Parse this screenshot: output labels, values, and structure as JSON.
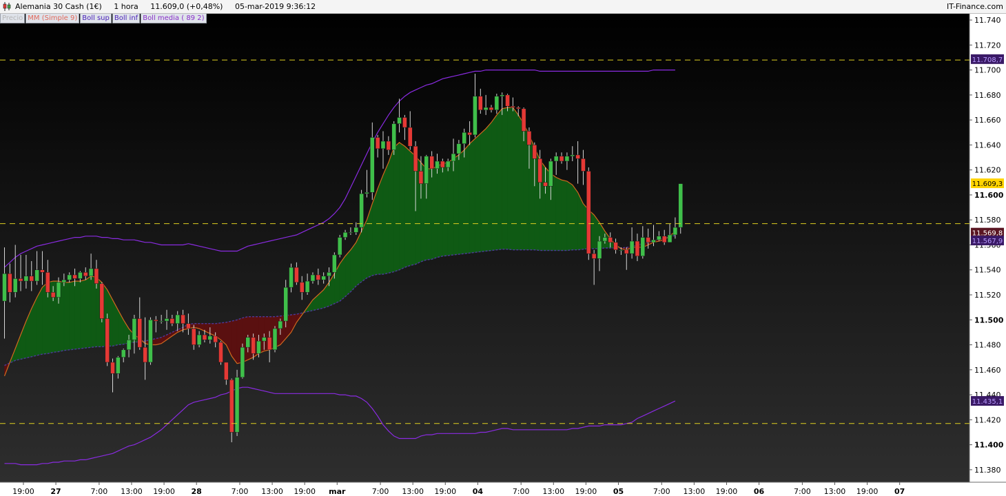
{
  "header": {
    "instrument": "Alemania 30 Cash (1€)",
    "timeframe": "1 hora",
    "quote": "11.609,0 (+0,48%)",
    "timestamp": "05-mar-2019 9:36:12",
    "brand": "IT-Finance.com"
  },
  "legend": [
    {
      "label": "Precio"
    },
    {
      "label": "MM (Simple 9)"
    },
    {
      "label": "Boll sup"
    },
    {
      "label": "Boll inf"
    },
    {
      "label": "Boll media ( 89 2)"
    }
  ],
  "colors": {
    "up": "#3fbf4a",
    "down": "#e53935",
    "sma": "#d2691e",
    "bollinger": "#8a2be2",
    "level": "#e0d020",
    "fill_above": "#0f5a14",
    "fill_below": "#5a1010",
    "last_price_tag": "#ffd400"
  },
  "chart_data": {
    "type": "candlestick",
    "ylim": [
      11370,
      11745
    ],
    "yticks": [
      "11.740",
      "11.720",
      "11.700",
      "11.680",
      "11.660",
      "11.640",
      "11.620",
      "11.600",
      "11.580",
      "11.560",
      "11.540",
      "11.520",
      "11.500",
      "11.480",
      "11.460",
      "11.440",
      "11.420",
      "11.400",
      "11.380"
    ],
    "yticks_bold": [
      "11.600",
      "11.500",
      "11.400"
    ],
    "xticks": [
      {
        "i": 3.5,
        "label": "19:00",
        "bold": false
      },
      {
        "i": 9.5,
        "label": "27",
        "bold": true
      },
      {
        "i": 17.5,
        "label": "7:00",
        "bold": false
      },
      {
        "i": 23.5,
        "label": "13:00",
        "bold": false
      },
      {
        "i": 29.5,
        "label": "19:00",
        "bold": false
      },
      {
        "i": 35.5,
        "label": "28",
        "bold": true
      },
      {
        "i": 43.5,
        "label": "7:00",
        "bold": false
      },
      {
        "i": 49.5,
        "label": "13:00",
        "bold": false
      },
      {
        "i": 55.5,
        "label": "19:00",
        "bold": false
      },
      {
        "i": 61.5,
        "label": "mar",
        "bold": true
      },
      {
        "i": 69.5,
        "label": "7:00",
        "bold": false
      },
      {
        "i": 75.5,
        "label": "13:00",
        "bold": false
      },
      {
        "i": 81.5,
        "label": "19:00",
        "bold": false
      },
      {
        "i": 87.5,
        "label": "04",
        "bold": true
      },
      {
        "i": 95.5,
        "label": "7:00",
        "bold": false
      },
      {
        "i": 101.5,
        "label": "13:00",
        "bold": false
      },
      {
        "i": 107.5,
        "label": "19:00",
        "bold": false
      },
      {
        "i": 113.5,
        "label": "05",
        "bold": true
      },
      {
        "i": 121.5,
        "label": "7:00",
        "bold": false
      },
      {
        "i": 127.5,
        "label": "13:00",
        "bold": false
      },
      {
        "i": 133.5,
        "label": "19:00",
        "bold": false
      },
      {
        "i": 139.5,
        "label": "06",
        "bold": true
      },
      {
        "i": 147.5,
        "label": "7:00",
        "bold": false
      },
      {
        "i": 153.5,
        "label": "13:00",
        "bold": false
      },
      {
        "i": 159.5,
        "label": "19:00",
        "bold": false
      },
      {
        "i": 165.5,
        "label": "07",
        "bold": true
      }
    ],
    "candles": [
      [
        11515,
        11537,
        11558,
        11485
      ],
      [
        11537,
        11522,
        11545,
        11514
      ],
      [
        11522,
        11533,
        11560,
        11518
      ],
      [
        11533,
        11531,
        11552,
        11523
      ],
      [
        11531,
        11535,
        11552,
        11525
      ],
      [
        11535,
        11531,
        11547,
        11523
      ],
      [
        11531,
        11540,
        11555,
        11528
      ],
      [
        11540,
        11538,
        11555,
        11528
      ],
      [
        11538,
        11522,
        11548,
        11518
      ],
      [
        11522,
        11518,
        11527,
        11515
      ],
      [
        11518,
        11530,
        11534,
        11513
      ],
      [
        11530,
        11532,
        11537,
        11527
      ],
      [
        11532,
        11536,
        11538,
        11530
      ],
      [
        11536,
        11533,
        11541,
        11527
      ],
      [
        11533,
        11538,
        11539,
        11530
      ],
      [
        11538,
        11535,
        11542,
        11532
      ],
      [
        11535,
        11541,
        11553,
        11532
      ],
      [
        11541,
        11529,
        11548,
        11525
      ],
      [
        11529,
        11501,
        11530,
        11498
      ],
      [
        11501,
        11466,
        11505,
        11463
      ],
      [
        11466,
        11457,
        11469,
        11442
      ],
      [
        11457,
        11470,
        11471,
        11453
      ],
      [
        11470,
        11476,
        11477,
        11466
      ],
      [
        11476,
        11484,
        11488,
        11470
      ],
      [
        11484,
        11501,
        11504,
        11473
      ],
      [
        11501,
        11478,
        11518,
        11476
      ],
      [
        11478,
        11466,
        11502,
        11452
      ],
      [
        11466,
        11500,
        11502,
        11464
      ],
      [
        11500,
        11499,
        11503,
        11490
      ],
      [
        11499,
        11499,
        11504,
        11497
      ],
      [
        11499,
        11501,
        11508,
        11492
      ],
      [
        11501,
        11497,
        11504,
        11495
      ],
      [
        11497,
        11504,
        11507,
        11491
      ],
      [
        11504,
        11497,
        11508,
        11490
      ],
      [
        11497,
        11493,
        11505,
        11488
      ],
      [
        11493,
        11480,
        11496,
        11476
      ],
      [
        11480,
        11488,
        11491,
        11478
      ],
      [
        11488,
        11484,
        11492,
        11482
      ],
      [
        11484,
        11487,
        11494,
        11481
      ],
      [
        11487,
        11482,
        11490,
        11478
      ],
      [
        11482,
        11466,
        11483,
        11464
      ],
      [
        11466,
        11452,
        11466,
        11448
      ],
      [
        11452,
        11410,
        11453,
        11402
      ],
      [
        11410,
        11454,
        11460,
        11407
      ],
      [
        11454,
        11478,
        11481,
        11453
      ],
      [
        11478,
        11486,
        11488,
        11474
      ],
      [
        11486,
        11473,
        11489,
        11468
      ],
      [
        11473,
        11483,
        11488,
        11470
      ],
      [
        11483,
        11486,
        11489,
        11476
      ],
      [
        11486,
        11476,
        11491,
        11466
      ],
      [
        11476,
        11493,
        11495,
        11474
      ],
      [
        11493,
        11499,
        11501,
        11488
      ],
      [
        11499,
        11526,
        11532,
        11494
      ],
      [
        11526,
        11542,
        11545,
        11522
      ],
      [
        11542,
        11530,
        11546,
        11528
      ],
      [
        11530,
        11522,
        11535,
        11516
      ],
      [
        11522,
        11531,
        11537,
        11520
      ],
      [
        11531,
        11536,
        11538,
        11529
      ],
      [
        11536,
        11532,
        11541,
        11528
      ],
      [
        11532,
        11535,
        11538,
        11529
      ],
      [
        11535,
        11538,
        11542,
        11527
      ],
      [
        11538,
        11552,
        11554,
        11533
      ],
      [
        11552,
        11566,
        11568,
        11550
      ],
      [
        11566,
        11570,
        11572,
        11564
      ],
      [
        11570,
        11570,
        11574,
        11568
      ],
      [
        11570,
        11574,
        11578,
        11568
      ],
      [
        11574,
        11601,
        11604,
        11570
      ],
      [
        11601,
        11602,
        11620,
        11598
      ],
      [
        11602,
        11646,
        11658,
        11596
      ],
      [
        11646,
        11637,
        11648,
        11630
      ],
      [
        11637,
        11643,
        11651,
        11621
      ],
      [
        11643,
        11636,
        11647,
        11632
      ],
      [
        11636,
        11657,
        11659,
        11632
      ],
      [
        11657,
        11662,
        11677,
        11650
      ],
      [
        11662,
        11654,
        11664,
        11644
      ],
      [
        11654,
        11639,
        11667,
        11636
      ],
      [
        11639,
        11619,
        11643,
        11587
      ],
      [
        11619,
        11609,
        11631,
        11597
      ],
      [
        11609,
        11631,
        11632,
        11597
      ],
      [
        11631,
        11621,
        11635,
        11614
      ],
      [
        11621,
        11627,
        11633,
        11617
      ],
      [
        11627,
        11622,
        11629,
        11618
      ],
      [
        11622,
        11627,
        11629,
        11619
      ],
      [
        11627,
        11633,
        11645,
        11619
      ],
      [
        11633,
        11641,
        11644,
        11628
      ],
      [
        11641,
        11650,
        11653,
        11630
      ],
      [
        11650,
        11648,
        11659,
        11640
      ],
      [
        11648,
        11679,
        11697,
        11646
      ],
      [
        11679,
        11668,
        11685,
        11665
      ],
      [
        11668,
        11670,
        11680,
        11664
      ],
      [
        11670,
        11668,
        11672,
        11666
      ],
      [
        11668,
        11679,
        11681,
        11665
      ],
      [
        11679,
        11680,
        11682,
        11664
      ],
      [
        11680,
        11671,
        11681,
        11667
      ],
      [
        11671,
        11670,
        11678,
        11667
      ],
      [
        11670,
        11669,
        11671,
        11663
      ],
      [
        11669,
        11651,
        11670,
        11643
      ],
      [
        11651,
        11640,
        11654,
        11621
      ],
      [
        11640,
        11629,
        11642,
        11607
      ],
      [
        11629,
        11610,
        11636,
        11597
      ],
      [
        11610,
        11607,
        11622,
        11601
      ],
      [
        11607,
        11627,
        11629,
        11596
      ],
      [
        11627,
        11631,
        11634,
        11616
      ],
      [
        11631,
        11627,
        11634,
        11625
      ],
      [
        11627,
        11631,
        11634,
        11620
      ],
      [
        11631,
        11632,
        11639,
        11627
      ],
      [
        11632,
        11629,
        11643,
        11609
      ],
      [
        11629,
        11619,
        11636,
        11608
      ],
      [
        11619,
        11553,
        11622,
        11548
      ],
      [
        11553,
        11549,
        11556,
        11528
      ],
      [
        11549,
        11563,
        11567,
        11539
      ],
      [
        11563,
        11566,
        11569,
        11561
      ],
      [
        11566,
        11562,
        11570,
        11558
      ],
      [
        11562,
        11556,
        11565,
        11553
      ],
      [
        11556,
        11556,
        11558,
        11552
      ],
      [
        11556,
        11553,
        11558,
        11540
      ],
      [
        11553,
        11563,
        11574,
        11549
      ],
      [
        11563,
        11551,
        11569,
        11547
      ],
      [
        11551,
        11566,
        11575,
        11549
      ],
      [
        11566,
        11562,
        11573,
        11557
      ],
      [
        11562,
        11564,
        11576,
        11559
      ],
      [
        11564,
        11567,
        11571,
        11563
      ],
      [
        11567,
        11562,
        11572,
        11560
      ],
      [
        11562,
        11568,
        11577,
        11562
      ],
      [
        11568,
        11574,
        11582,
        11565
      ],
      [
        11574,
        11609,
        11609,
        11569
      ]
    ],
    "sma9": [
      11455,
      11466,
      11477,
      11488,
      11499,
      11509,
      11518,
      11526,
      11530,
      11531,
      11531,
      11530,
      11530,
      11531,
      11531,
      11532,
      11535,
      11534,
      11530,
      11524,
      11516,
      11508,
      11500,
      11493,
      11488,
      11485,
      11481,
      11480,
      11480,
      11481,
      11484,
      11487,
      11490,
      11492,
      11493,
      11494,
      11493,
      11491,
      11489,
      11487,
      11484,
      11480,
      11471,
      11465,
      11466,
      11468,
      11470,
      11473,
      11475,
      11476,
      11478,
      11480,
      11485,
      11490,
      11498,
      11504,
      11510,
      11516,
      11520,
      11524,
      11530,
      11537,
      11545,
      11551,
      11556,
      11562,
      11571,
      11580,
      11593,
      11605,
      11616,
      11626,
      11638,
      11642,
      11639,
      11635,
      11631,
      11626,
      11621,
      11621,
      11623,
      11625,
      11626,
      11629,
      11632,
      11636,
      11641,
      11645,
      11649,
      11653,
      11658,
      11664,
      11669,
      11670,
      11670,
      11664,
      11657,
      11648,
      11638,
      11628,
      11622,
      11617,
      11614,
      11612,
      11611,
      11608,
      11602,
      11593,
      11588,
      11584,
      11578,
      11571,
      11565,
      11560,
      11557,
      11556,
      11558,
      11558,
      11558,
      11560,
      11562,
      11563,
      11564,
      11567,
      11571
    ]
  },
  "bollinger": {
    "upper": [
      11542,
      11546,
      11550,
      11553,
      11555,
      11557,
      11559,
      11560,
      11561,
      11562,
      11563,
      11564,
      11565,
      11566,
      11566,
      11567,
      11567,
      11567,
      11566,
      11566,
      11565,
      11565,
      11564,
      11564,
      11564,
      11563,
      11562,
      11562,
      11561,
      11560,
      11560,
      11560,
      11560,
      11560,
      11561,
      11560,
      11559,
      11558,
      11557,
      11556,
      11555,
      11555,
      11555,
      11555,
      11557,
      11559,
      11560,
      11561,
      11562,
      11563,
      11564,
      11565,
      11566,
      11567,
      11568,
      11570,
      11572,
      11574,
      11576,
      11578,
      11581,
      11585,
      11590,
      11597,
      11606,
      11615,
      11624,
      11633,
      11642,
      11650,
      11657,
      11664,
      11670,
      11675,
      11679,
      11682,
      11684,
      11686,
      11688,
      11689,
      11691,
      11693,
      11694,
      11695,
      11696,
      11697,
      11698,
      11699,
      11699,
      11700,
      11700,
      11700,
      11700,
      11700,
      11700,
      11700,
      11700,
      11700,
      11700,
      11699,
      11699,
      11699,
      11699,
      11699,
      11699,
      11699,
      11699,
      11699,
      11699,
      11699,
      11699,
      11699,
      11699,
      11699,
      11699,
      11699,
      11699,
      11699,
      11699,
      11699,
      11700,
      11700,
      11700,
      11700,
      11700
    ],
    "lower": [
      11385,
      11385,
      11385,
      11384,
      11384,
      11384,
      11384,
      11385,
      11385,
      11386,
      11386,
      11387,
      11387,
      11387,
      11388,
      11388,
      11389,
      11390,
      11391,
      11392,
      11393,
      11395,
      11397,
      11399,
      11400,
      11402,
      11404,
      11406,
      11409,
      11412,
      11416,
      11420,
      11424,
      11428,
      11432,
      11434,
      11435,
      11436,
      11437,
      11438,
      11440,
      11441,
      11443,
      11445,
      11446,
      11446,
      11445,
      11444,
      11443,
      11442,
      11441,
      11441,
      11441,
      11441,
      11441,
      11441,
      11441,
      11441,
      11441,
      11441,
      11441,
      11441,
      11440,
      11440,
      11439,
      11439,
      11437,
      11434,
      11429,
      11423,
      11416,
      11411,
      11407,
      11405,
      11405,
      11405,
      11405,
      11407,
      11408,
      11408,
      11409,
      11409,
      11409,
      11409,
      11409,
      11409,
      11409,
      11409,
      11410,
      11410,
      11411,
      11412,
      11413,
      11413,
      11412,
      11412,
      11412,
      11412,
      11412,
      11412,
      11412,
      11412,
      11412,
      11412,
      11412,
      11413,
      11413,
      11414,
      11415,
      11415,
      11415,
      11416,
      11416,
      11416,
      11416,
      11417,
      11418,
      11421,
      11423,
      11425,
      11427,
      11429,
      11431,
      11433,
      11435
    ]
  },
  "levels": [
    11708,
    11577,
    11417
  ],
  "level_color": "#e0d020",
  "tags": [
    {
      "label": "11.708,7",
      "value": 11708.7,
      "bg": "#3a1a66",
      "fg": "#b99cff"
    },
    {
      "label": "11.609,3",
      "value": 11609.3,
      "bg": "#ffd400",
      "fg": "#000000"
    },
    {
      "label": "11.569,8",
      "value": 11569.8,
      "bg": "#5a1622",
      "fg": "#ffffff"
    },
    {
      "label": "11.567,9",
      "value": 11563.5,
      "bg": "#3a1a66",
      "fg": "#b99cff"
    },
    {
      "label": "11.435,1",
      "value": 11435.1,
      "bg": "#3a1a66",
      "fg": "#b99cff"
    }
  ],
  "copyright": "© IT-Finance.com"
}
